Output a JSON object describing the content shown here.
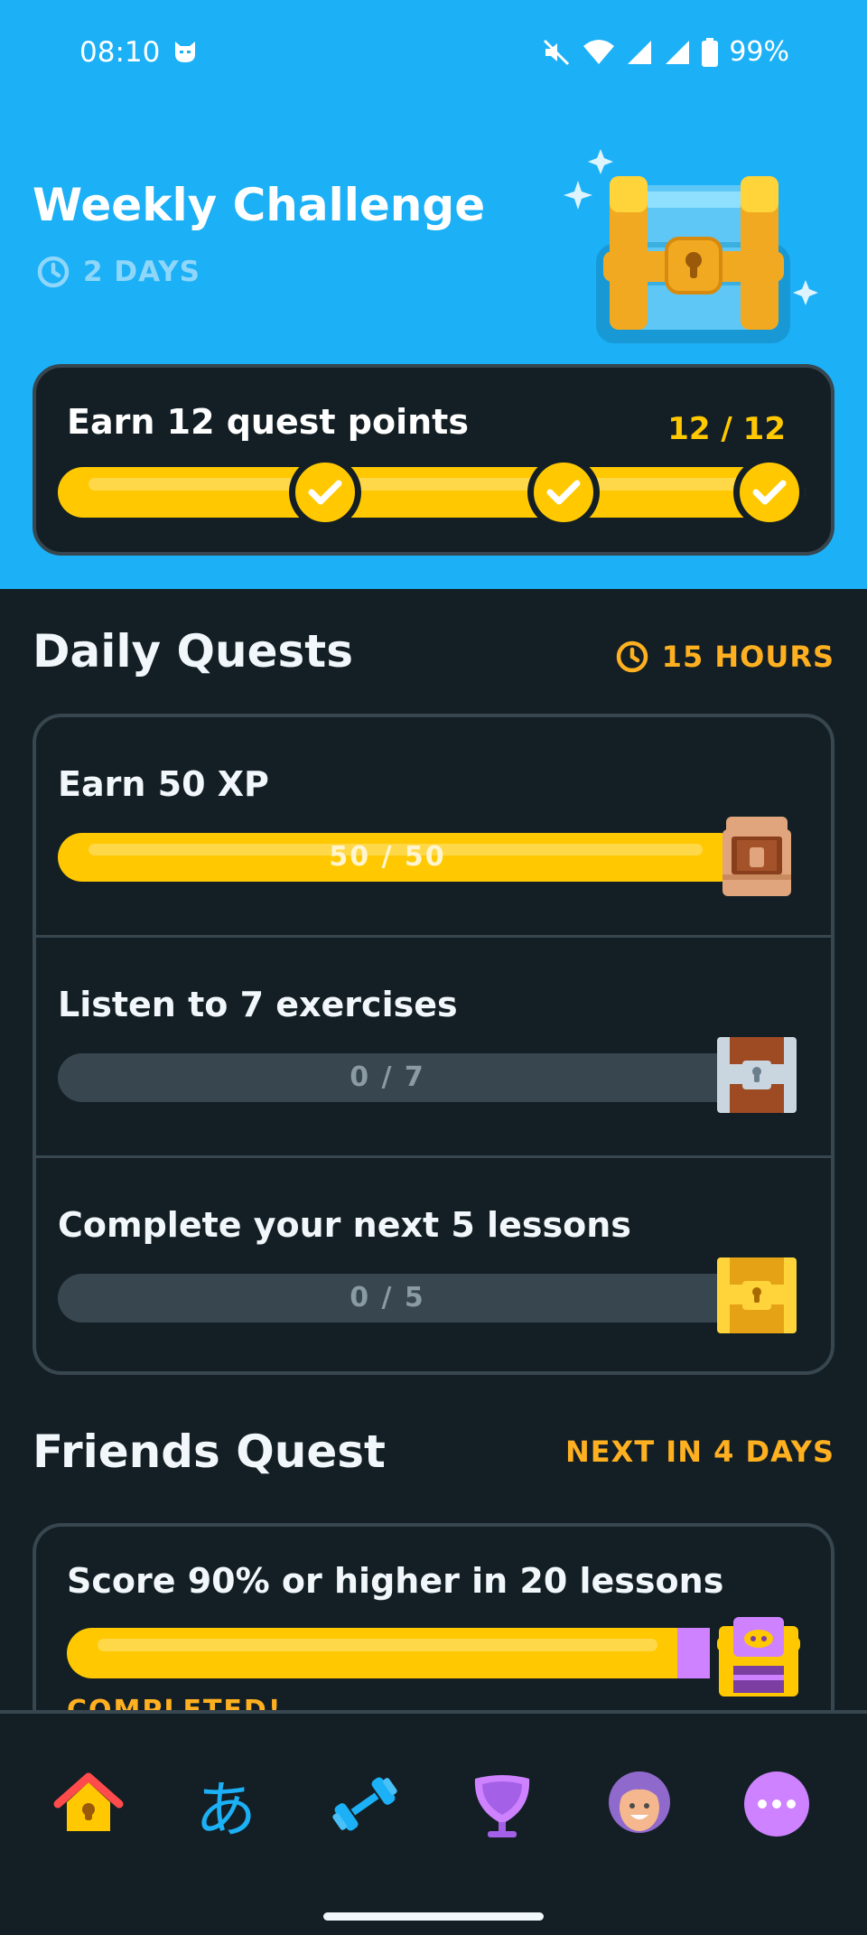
{
  "status_bar": {
    "time": "08:10",
    "battery": "99%"
  },
  "weekly_challenge": {
    "title": "Weekly Challenge",
    "time_left": "2 DAYS",
    "goal_label": "Earn 12 quest points",
    "progress_text": "12 / 12"
  },
  "daily_quests": {
    "title": "Daily Quests",
    "time_left": "15 HOURS",
    "items": [
      {
        "label": "Earn 50 XP",
        "progress_text": "50 / 50",
        "progress": 1.0
      },
      {
        "label": "Listen to 7 exercises",
        "progress_text": "0 / 7",
        "progress": 0
      },
      {
        "label": "Complete your next 5 lessons",
        "progress_text": "0 / 5",
        "progress": 0
      }
    ]
  },
  "friends_quest": {
    "title": "Friends Quest",
    "next_in": "NEXT IN 4 DAYS",
    "goal_label": "Score 90% or higher in 20 lessons",
    "status": "COMPLETED!"
  },
  "bottom_nav": {
    "items": [
      "home",
      "characters",
      "practice",
      "leaderboards",
      "profile",
      "more"
    ],
    "icons": [
      "house-icon",
      "hiragana-icon",
      "dumbbell-icon",
      "shield-icon",
      "avatar-icon",
      "more-icon"
    ],
    "characters_glyph": "あ"
  },
  "colors": {
    "accent_blue": "#1CB0F6",
    "gold": "#FFC800",
    "orange_text": "#FFB020",
    "background": "#131F24",
    "border": "#37464F",
    "purple": "#CE82FF"
  }
}
